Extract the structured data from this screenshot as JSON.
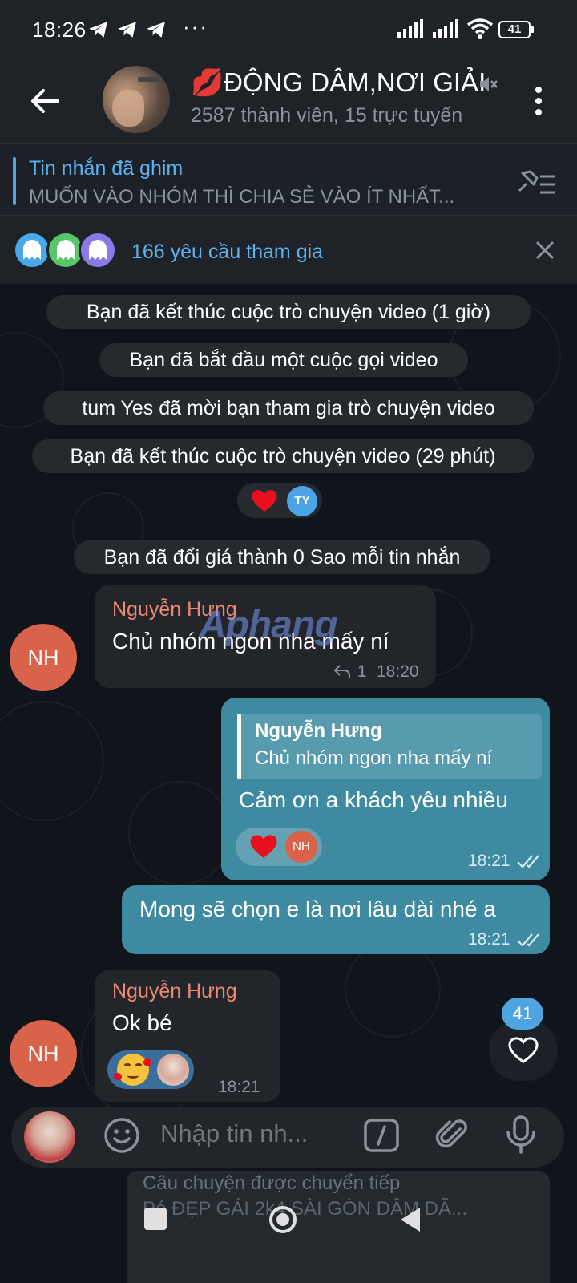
{
  "status": {
    "time": "18:26",
    "dots": "···",
    "battery": "41"
  },
  "header": {
    "title": "💋ĐỘNG DÂM,NƠI GIẢI",
    "subtitle": "2587 thành viên, 15 trực tuyến"
  },
  "pinned": {
    "title": "Tin nhắn đã ghim",
    "text": "MUỐN VÀO NHÓM THÌ CHIA SẺ VÀO ÍT NHẤT..."
  },
  "join_requests": {
    "label": "166 yêu cầu tham gia"
  },
  "messages": {
    "service1": "Bạn đã kết thúc cuộc trò chuyện video (1 giờ)",
    "service2": "Bạn đã bắt đầu một cuộc gọi video",
    "service3": "tum Yes đã mời bạn tham gia trò chuyện video",
    "service4": "Bạn đã kết thúc cuộc trò chuyện video (29 phút)",
    "reaction_user1": "TY",
    "service5": "Bạn đã đổi giá thành 0 Sao mỗi tin nhắn",
    "m1_sender": "Nguyễn Hưng",
    "m1_text": "Chủ nhóm ngon nha mấy ní",
    "m1_replies": "1",
    "m1_time": "18:20",
    "m1_avatar": "NH",
    "watermark": "Aphang",
    "m2_reply_sender": "Nguyễn Hưng",
    "m2_reply_text": "Chủ nhóm ngon nha mấy ní",
    "m2_text": "Cảm ơn a khách yêu nhiều",
    "m2_reaction_user": "NH",
    "m2_time": "18:21",
    "m3_text": "Mong sẽ chọn e là nơi lâu dài nhé a",
    "m3_time": "18:21",
    "m4_sender": "Nguyễn Hưng",
    "m4_text": "Ok bé",
    "m4_time": "18:21",
    "m4_avatar": "NH"
  },
  "unread_count": "41",
  "input": {
    "placeholder": "Nhập tin nh..."
  },
  "forwarded": {
    "title": "Câu chuyện được chuyển tiếp",
    "subtitle": "Pé ĐẸP GÁI 2k4 SÀI GÒN DÂM DÃ..."
  },
  "colors": {
    "accent": "#5eb1ef",
    "outgoing_bubble": "#3d8aa1",
    "incoming_bubble": "#22262b",
    "sender_name": "#f08770"
  }
}
